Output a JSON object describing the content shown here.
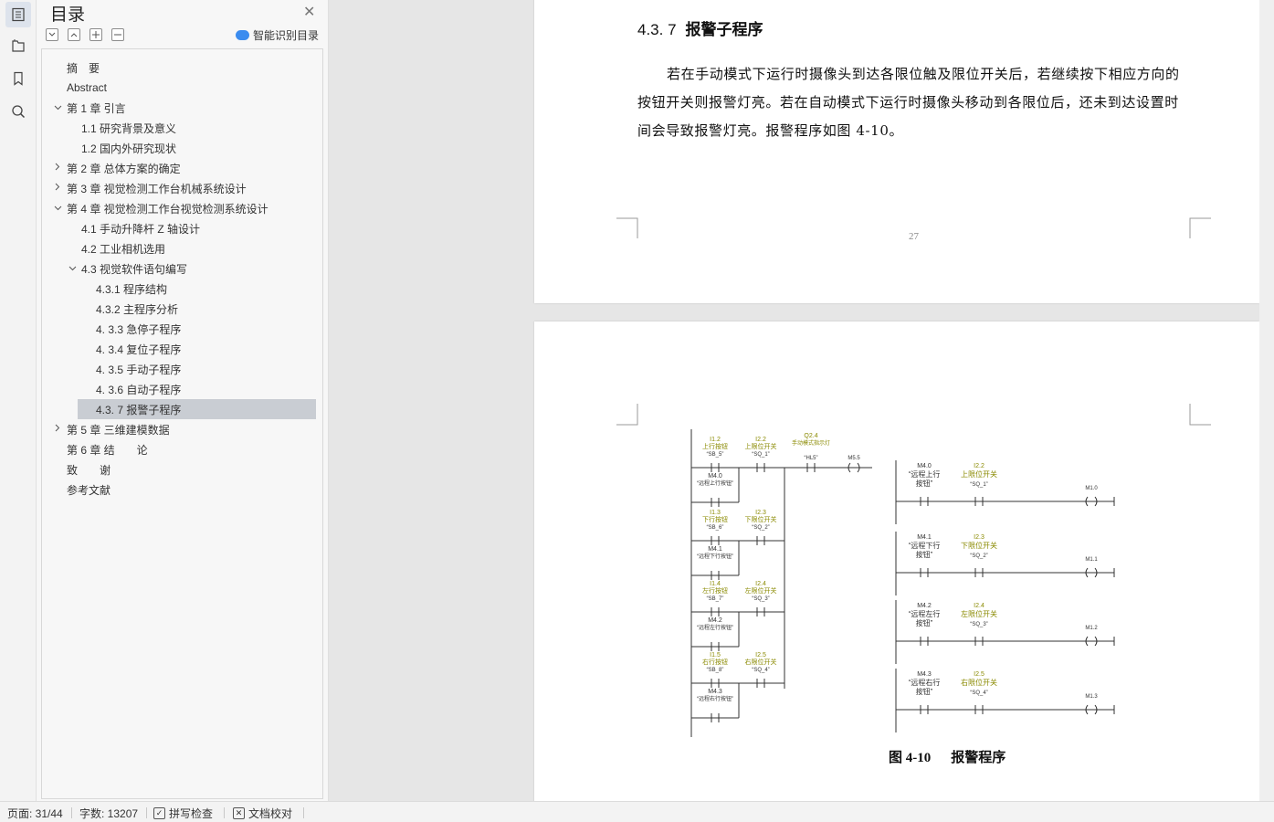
{
  "rail": {
    "icons": [
      "toc-icon",
      "outline-icon",
      "bookmark-icon",
      "search-icon"
    ]
  },
  "toc": {
    "title": "目录",
    "smart_label": "智能识别目录",
    "items": [
      {
        "label": "摘　要",
        "indent": 0,
        "arrow": ""
      },
      {
        "label": "Abstract",
        "indent": 0,
        "arrow": ""
      },
      {
        "label": "第 1 章  引言",
        "indent": 0,
        "arrow": "expanded"
      },
      {
        "label": "1.1 研究背景及意义",
        "indent": 1,
        "arrow": ""
      },
      {
        "label": "1.2 国内外研究现状",
        "indent": 1,
        "arrow": ""
      },
      {
        "label": "第 2 章  总体方案的确定",
        "indent": 0,
        "arrow": "collapsed"
      },
      {
        "label": "第 3 章  视觉检测工作台机械系统设计",
        "indent": 0,
        "arrow": "collapsed"
      },
      {
        "label": "第 4 章  视觉检测工作台视觉检测系统设计",
        "indent": 0,
        "arrow": "expanded"
      },
      {
        "label": "4.1  手动升降杆 Z 轴设计",
        "indent": 1,
        "arrow": ""
      },
      {
        "label": "4.2  工业相机选用",
        "indent": 1,
        "arrow": ""
      },
      {
        "label": "4.3  视觉软件语句编写",
        "indent": 1,
        "arrow": "expanded"
      },
      {
        "label": "4.3.1  程序结构",
        "indent": 2,
        "arrow": ""
      },
      {
        "label": "4.3.2  主程序分析",
        "indent": 2,
        "arrow": ""
      },
      {
        "label": "4. 3.3  急停子程序",
        "indent": 2,
        "arrow": ""
      },
      {
        "label": "4. 3.4  复位子程序",
        "indent": 2,
        "arrow": ""
      },
      {
        "label": "4. 3.5  手动子程序",
        "indent": 2,
        "arrow": ""
      },
      {
        "label": "4. 3.6  自动子程序",
        "indent": 2,
        "arrow": ""
      },
      {
        "label": "4.3. 7  报警子程序",
        "indent": 2,
        "arrow": "",
        "selected": true
      },
      {
        "label": "第 5 章  三维建模数据",
        "indent": 0,
        "arrow": "collapsed"
      },
      {
        "label": "第 6 章  结　　论",
        "indent": 0,
        "arrow": ""
      },
      {
        "label": "致　　谢",
        "indent": 0,
        "arrow": ""
      },
      {
        "label": "参考文献",
        "indent": 0,
        "arrow": ""
      }
    ]
  },
  "doc": {
    "heading_num": "4.3. 7",
    "heading_title": "报警子程序",
    "paragraph": "若在手动模式下运行时摄像头到达各限位触及限位开关后，若继续按下相应方向的按钮开关则报警灯亮。若在自动模式下运行时摄像头移动到各限位后，还未到达设置时间会导致报警灯亮。报警程序如图 4-10。",
    "page_number": "27",
    "figure_label": "图 4-10",
    "figure_title": "报警程序"
  },
  "ladder": {
    "left": [
      {
        "addr": "I1.2",
        "name": "上行按钮",
        "sym": "“SB_5”"
      },
      {
        "addr": "I2.2",
        "name": "上限位开关",
        "sym": "“SQ_1”"
      },
      {
        "addr": "Q2.4",
        "name": "手动模式指示灯",
        "sym": "“HL5”"
      },
      {
        "addr": "M5.5",
        "name": "",
        "sym": ""
      },
      {
        "addr": "M4.0",
        "name": "“远程上行按钮”",
        "sym": ""
      },
      {
        "addr": "I1.3",
        "name": "下行按钮",
        "sym": "“SB_6”"
      },
      {
        "addr": "I2.3",
        "name": "下限位开关",
        "sym": "“SQ_2”"
      },
      {
        "addr": "M4.1",
        "name": "“远程下行按钮”",
        "sym": ""
      },
      {
        "addr": "I1.4",
        "name": "左行按钮",
        "sym": "“SB_7”"
      },
      {
        "addr": "I2.4",
        "name": "左限位开关",
        "sym": "“SQ_3”"
      },
      {
        "addr": "M4.2",
        "name": "“远程左行按钮”",
        "sym": ""
      },
      {
        "addr": "I1.5",
        "name": "右行按钮",
        "sym": "“SB_8”"
      },
      {
        "addr": "I2.5",
        "name": "右限位开关",
        "sym": "“SQ_4”"
      },
      {
        "addr": "M4.3",
        "name": "“远程右行按钮”",
        "sym": ""
      }
    ],
    "right": [
      {
        "addr1": "M4.0",
        "name1": "“远程上行",
        "name1b": "按钮”",
        "addr2": "I2.2",
        "name2": "上限位开关",
        "sym2": "“SQ_1”",
        "coil": "M1.0"
      },
      {
        "addr1": "M4.1",
        "name1": "“远程下行",
        "name1b": "按钮”",
        "addr2": "I2.3",
        "name2": "下限位开关",
        "sym2": "“SQ_2”",
        "coil": "M1.1"
      },
      {
        "addr1": "M4.2",
        "name1": "“远程左行",
        "name1b": "按钮”",
        "addr2": "I2.4",
        "name2": "左限位开关",
        "sym2": "“SQ_3”",
        "coil": "M1.2"
      },
      {
        "addr1": "M4.3",
        "name1": "“远程右行",
        "name1b": "按钮”",
        "addr2": "I2.5",
        "name2": "右限位开关",
        "sym2": "“SQ_4”",
        "coil": "M1.3"
      }
    ]
  },
  "status": {
    "page": "页面: 31/44",
    "words": "字数: 13207",
    "spell": "拼写检查",
    "proof": "文档校对"
  },
  "colors": {
    "accent": "#3b8cef",
    "selected_bg": "#c9cdd3",
    "ladder_olive": "#8a8a00"
  }
}
